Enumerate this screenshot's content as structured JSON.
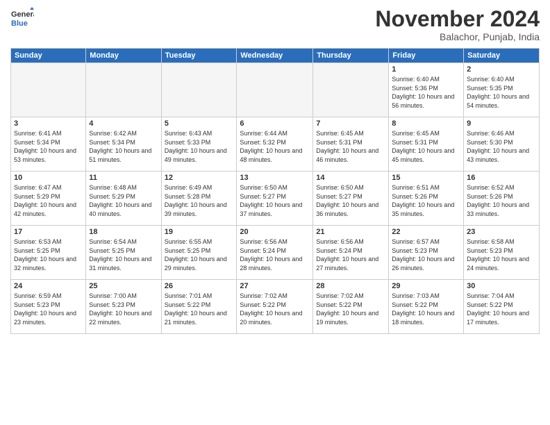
{
  "header": {
    "logo_general": "General",
    "logo_blue": "Blue",
    "month": "November 2024",
    "location": "Balachor, Punjab, India"
  },
  "days_of_week": [
    "Sunday",
    "Monday",
    "Tuesday",
    "Wednesday",
    "Thursday",
    "Friday",
    "Saturday"
  ],
  "weeks": [
    [
      {
        "day": "",
        "empty": true
      },
      {
        "day": "",
        "empty": true
      },
      {
        "day": "",
        "empty": true
      },
      {
        "day": "",
        "empty": true
      },
      {
        "day": "",
        "empty": true
      },
      {
        "day": "1",
        "sunrise": "6:40 AM",
        "sunset": "5:36 PM",
        "daylight": "10 hours and 56 minutes."
      },
      {
        "day": "2",
        "sunrise": "6:40 AM",
        "sunset": "5:35 PM",
        "daylight": "10 hours and 54 minutes."
      }
    ],
    [
      {
        "day": "3",
        "sunrise": "6:41 AM",
        "sunset": "5:34 PM",
        "daylight": "10 hours and 53 minutes."
      },
      {
        "day": "4",
        "sunrise": "6:42 AM",
        "sunset": "5:34 PM",
        "daylight": "10 hours and 51 minutes."
      },
      {
        "day": "5",
        "sunrise": "6:43 AM",
        "sunset": "5:33 PM",
        "daylight": "10 hours and 49 minutes."
      },
      {
        "day": "6",
        "sunrise": "6:44 AM",
        "sunset": "5:32 PM",
        "daylight": "10 hours and 48 minutes."
      },
      {
        "day": "7",
        "sunrise": "6:45 AM",
        "sunset": "5:31 PM",
        "daylight": "10 hours and 46 minutes."
      },
      {
        "day": "8",
        "sunrise": "6:45 AM",
        "sunset": "5:31 PM",
        "daylight": "10 hours and 45 minutes."
      },
      {
        "day": "9",
        "sunrise": "6:46 AM",
        "sunset": "5:30 PM",
        "daylight": "10 hours and 43 minutes."
      }
    ],
    [
      {
        "day": "10",
        "sunrise": "6:47 AM",
        "sunset": "5:29 PM",
        "daylight": "10 hours and 42 minutes."
      },
      {
        "day": "11",
        "sunrise": "6:48 AM",
        "sunset": "5:29 PM",
        "daylight": "10 hours and 40 minutes."
      },
      {
        "day": "12",
        "sunrise": "6:49 AM",
        "sunset": "5:28 PM",
        "daylight": "10 hours and 39 minutes."
      },
      {
        "day": "13",
        "sunrise": "6:50 AM",
        "sunset": "5:27 PM",
        "daylight": "10 hours and 37 minutes."
      },
      {
        "day": "14",
        "sunrise": "6:50 AM",
        "sunset": "5:27 PM",
        "daylight": "10 hours and 36 minutes."
      },
      {
        "day": "15",
        "sunrise": "6:51 AM",
        "sunset": "5:26 PM",
        "daylight": "10 hours and 35 minutes."
      },
      {
        "day": "16",
        "sunrise": "6:52 AM",
        "sunset": "5:26 PM",
        "daylight": "10 hours and 33 minutes."
      }
    ],
    [
      {
        "day": "17",
        "sunrise": "6:53 AM",
        "sunset": "5:25 PM",
        "daylight": "10 hours and 32 minutes."
      },
      {
        "day": "18",
        "sunrise": "6:54 AM",
        "sunset": "5:25 PM",
        "daylight": "10 hours and 31 minutes."
      },
      {
        "day": "19",
        "sunrise": "6:55 AM",
        "sunset": "5:25 PM",
        "daylight": "10 hours and 29 minutes."
      },
      {
        "day": "20",
        "sunrise": "6:56 AM",
        "sunset": "5:24 PM",
        "daylight": "10 hours and 28 minutes."
      },
      {
        "day": "21",
        "sunrise": "6:56 AM",
        "sunset": "5:24 PM",
        "daylight": "10 hours and 27 minutes."
      },
      {
        "day": "22",
        "sunrise": "6:57 AM",
        "sunset": "5:23 PM",
        "daylight": "10 hours and 26 minutes."
      },
      {
        "day": "23",
        "sunrise": "6:58 AM",
        "sunset": "5:23 PM",
        "daylight": "10 hours and 24 minutes."
      }
    ],
    [
      {
        "day": "24",
        "sunrise": "6:59 AM",
        "sunset": "5:23 PM",
        "daylight": "10 hours and 23 minutes."
      },
      {
        "day": "25",
        "sunrise": "7:00 AM",
        "sunset": "5:23 PM",
        "daylight": "10 hours and 22 minutes."
      },
      {
        "day": "26",
        "sunrise": "7:01 AM",
        "sunset": "5:22 PM",
        "daylight": "10 hours and 21 minutes."
      },
      {
        "day": "27",
        "sunrise": "7:02 AM",
        "sunset": "5:22 PM",
        "daylight": "10 hours and 20 minutes."
      },
      {
        "day": "28",
        "sunrise": "7:02 AM",
        "sunset": "5:22 PM",
        "daylight": "10 hours and 19 minutes."
      },
      {
        "day": "29",
        "sunrise": "7:03 AM",
        "sunset": "5:22 PM",
        "daylight": "10 hours and 18 minutes."
      },
      {
        "day": "30",
        "sunrise": "7:04 AM",
        "sunset": "5:22 PM",
        "daylight": "10 hours and 17 minutes."
      }
    ]
  ]
}
